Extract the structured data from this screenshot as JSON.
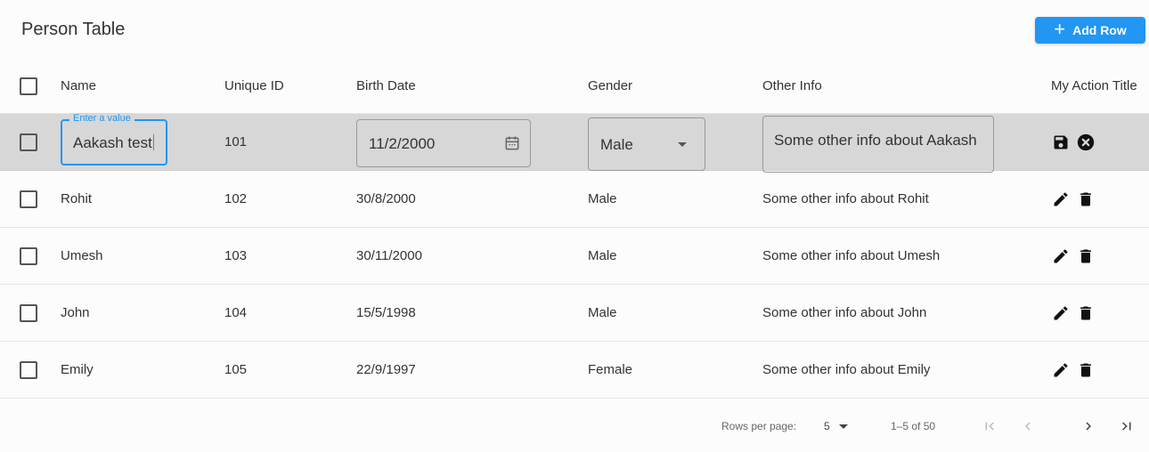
{
  "toolbar": {
    "title": "Person Table",
    "add_label": "Add Row",
    "add_icon": "plus-icon",
    "accent_color": "#2196f3"
  },
  "columns": [
    "Name",
    "Unique ID",
    "Birth Date",
    "Gender",
    "Other Info",
    "My Action Title"
  ],
  "editing_row": {
    "name_label": "Enter a value",
    "name_value": "Aakash test",
    "id": "101",
    "birth_date": "11/2/2000",
    "gender": "Male",
    "other_info": "Some other info about Aakash",
    "actions": [
      "save-icon",
      "cancel-icon"
    ],
    "background": "#d7d7d7"
  },
  "rows": [
    {
      "name": "Rohit",
      "id": "102",
      "birth_date": "30/8/2000",
      "gender": "Male",
      "other_info": "Some other info about Rohit"
    },
    {
      "name": "Umesh",
      "id": "103",
      "birth_date": "30/11/2000",
      "gender": "Male",
      "other_info": "Some other info about Umesh"
    },
    {
      "name": "John",
      "id": "104",
      "birth_date": "15/5/1998",
      "gender": "Male",
      "other_info": "Some other info about John"
    },
    {
      "name": "Emily",
      "id": "105",
      "birth_date": "22/9/1997",
      "gender": "Female",
      "other_info": "Some other info about Emily"
    }
  ],
  "row_actions": [
    "edit-icon",
    "delete-icon"
  ],
  "pagination": {
    "rows_per_page_label": "Rows per page:",
    "rows_per_page_value": "5",
    "range": "1–5 of 50",
    "buttons": [
      "first-page-icon",
      "previous-page-icon",
      "next-page-icon",
      "last-page-icon"
    ]
  }
}
